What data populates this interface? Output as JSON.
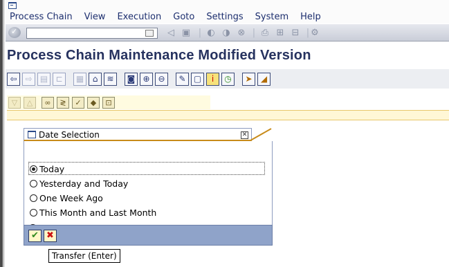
{
  "menu": {
    "items": [
      "Process Chain",
      "View",
      "Execution",
      "Goto",
      "Settings",
      "System",
      "Help"
    ]
  },
  "std_toolbar": {
    "command_value": "",
    "icons": [
      "enter-icon",
      "save-icon",
      "back-icon",
      "exit-icon",
      "cancel-icon",
      "print-icon",
      "find-icon",
      "find-next-icon"
    ]
  },
  "title": {
    "text": "Process Chain Maintenance Modified Version"
  },
  "app_toolbar": {
    "icons": [
      "back-arrow-icon",
      "forward-arrow-icon",
      "display-icon",
      "hierarchy-icon",
      "grid-icon",
      "change-icon",
      "save-variant-icon",
      "refresh-icon",
      "zoom-in-icon",
      "zoom-out-icon",
      "pencil-icon",
      "new-page-icon",
      "info-icon",
      "clock-icon",
      "execute-icon"
    ]
  },
  "work_toolbar": {
    "icons": [
      "collapse-icon",
      "expand-icon",
      "link-icon",
      "merge-icon",
      "check-icon",
      "activate-icon",
      "schedule-icon"
    ]
  },
  "dialog": {
    "title": "Date Selection",
    "options": [
      {
        "label": "Today",
        "selected": true
      },
      {
        "label": "Yesterday and Today",
        "selected": false
      },
      {
        "label": "One Week Ago",
        "selected": false
      },
      {
        "label": "This Month and Last Month",
        "selected": false
      },
      {
        "label": "Free Date...",
        "selected": false
      }
    ],
    "tooltip": "Transfer  (Enter)"
  },
  "colors": {
    "title": "#26325f",
    "menu_text": "#1c2e6e",
    "dialog_footer": "#8fa3c9",
    "accent_orange": "#c88b1a",
    "cancel_red": "#cc1111",
    "transfer_green": "#2e8a1e"
  }
}
